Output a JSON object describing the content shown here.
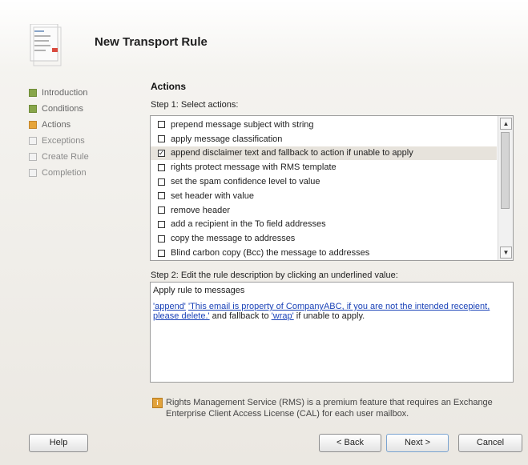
{
  "window": {
    "title": "New Transport Rule"
  },
  "wizard_steps": [
    {
      "label": "Introduction",
      "state": "done"
    },
    {
      "label": "Conditions",
      "state": "done"
    },
    {
      "label": "Actions",
      "state": "current"
    },
    {
      "label": "Exceptions",
      "state": "todo"
    },
    {
      "label": "Create Rule",
      "state": "todo"
    },
    {
      "label": "Completion",
      "state": "todo"
    }
  ],
  "section_title": "Actions",
  "step1": {
    "label": "Step 1: Select actions:",
    "items": [
      {
        "label": "prepend message subject with string",
        "checked": false
      },
      {
        "label": "apply message classification",
        "checked": false
      },
      {
        "label": "append disclaimer text and fallback to action if unable to apply",
        "checked": true
      },
      {
        "label": "rights protect message with RMS template",
        "checked": false
      },
      {
        "label": "set the spam confidence level to value",
        "checked": false
      },
      {
        "label": "set header with value",
        "checked": false
      },
      {
        "label": "remove header",
        "checked": false
      },
      {
        "label": "add a recipient in the To field addresses",
        "checked": false
      },
      {
        "label": "copy the message to addresses",
        "checked": false
      },
      {
        "label": "Blind carbon copy (Bcc) the message to addresses",
        "checked": false
      }
    ]
  },
  "step2": {
    "label": "Step 2: Edit the rule description by clicking an underlined value:",
    "line1": "Apply rule to messages",
    "link_append": "'append'",
    "link_text": "'This email is property of CompanyABC, if you are not the intended recepient, please delete.'",
    "middle_text": " and fallback to ",
    "link_wrap": "'wrap'",
    "end_text": " if unable to apply."
  },
  "info": {
    "text": "Rights Management Service (RMS) is a premium feature that requires an Exchange Enterprise Client Access License (CAL) for each user mailbox."
  },
  "buttons": {
    "help": "Help",
    "back": "< Back",
    "next": "Next >",
    "cancel": "Cancel"
  }
}
